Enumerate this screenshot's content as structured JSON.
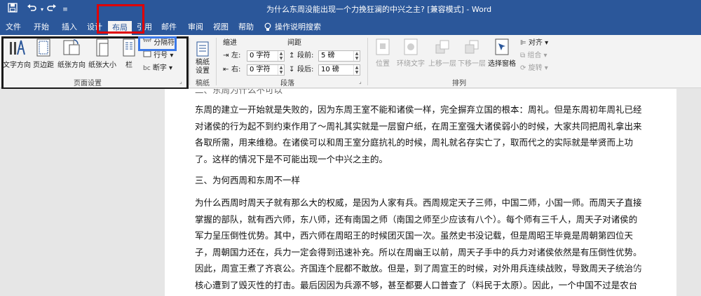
{
  "titlebar": {
    "save_icon": "save-icon",
    "undo_icon": "undo-icon",
    "redo_icon": "redo-icon",
    "customize_icon": "customize-quick-access-icon",
    "title": "为什么东周没能出现一个力挽狂澜的中兴之主? [兼容模式] - Word"
  },
  "tabs": [
    "文件",
    "开始",
    "插入",
    "设计",
    "布局",
    "引用",
    "邮件",
    "审阅",
    "视图",
    "帮助"
  ],
  "active_tab": "布局",
  "tell_me": "操作说明搜索",
  "ribbon": {
    "page_setup": {
      "text_direction": "文字方向",
      "margins": "页边距",
      "orientation": "纸张方向",
      "size": "纸张大小",
      "columns": "栏",
      "breaks": "分隔符",
      "line_numbers": "行号",
      "hyphenation": "断字",
      "label": "页面设置"
    },
    "draft": {
      "label": "稿纸",
      "button": "稿纸设置"
    },
    "paragraph": {
      "indent_title": "缩进",
      "spacing_title": "间距",
      "left_label": "左:",
      "left_value": "0 字符",
      "right_label": "右:",
      "right_value": "0 字符",
      "before_label": "段前:",
      "before_value": "5 磅",
      "after_label": "段后:",
      "after_value": "10 磅",
      "label": "段落"
    },
    "arrange": {
      "position": "位置",
      "wrap_text": "环绕文字",
      "bring_forward": "上移一层",
      "send_backward": "下移一层",
      "selection_pane": "选择窗格",
      "align": "对齐",
      "group": "组合",
      "rotate": "旋转",
      "label": "排列"
    }
  },
  "document": {
    "top_partial": "二、东周为什么不可以",
    "para1": "东周的建立一开始就是失败的，因为东周王室不能和诸侯一样，完全摒弃立国的根本：周礼。但是东周初年周礼已经对诸侯的行为起不到约束作用了～周礼其实就是一层窗户纸，在周王室强大诸侯弱小的时候，大家共同把周礼拿出来各取所需，用来维稳。在诸侯可以和周王室分庭抗礼的时候，周礼就名存实亡了，取而代之的实际就是举贤而上功了。这样的情况下是不可能出现一个中兴之主的。",
    "heading3": "三、为何西周和东周不一样",
    "para2": "为什么西周时周天子就有那么大的权威，是因为人家有兵。西周规定天子三师，中国二师，小国一师。而周天子直接掌握的部队，就有西六师，东八师，还有南国之师（南国之师至少应该有八个）。每个师有三千人，周天子对诸侯的军力呈压倒性优势。其中，西六师在周昭王的时候团灭国一次。虽然史书没记载，但是周昭王毕竟是周朝第四位天子，周朝国力还在，兵力一定会得到迅速补充。所以在周幽王以前，周天子手中的兵力对诸侯依然是有压倒性优势。因此，周宣王煮了齐哀公。齐国连个屁都不敢放。但是，到了周宣王的时候，对外用兵连续战败，导致周天子统治的核心遭到了毁灭性的打击。最后因因为兵源不够，甚至都要人口普查了（料民于太原）。因此，一个中国不过是农台了犬戎，就把宗周攻陷而且还办了周幽王，这就不难解释了。"
  },
  "watermark": "经验"
}
